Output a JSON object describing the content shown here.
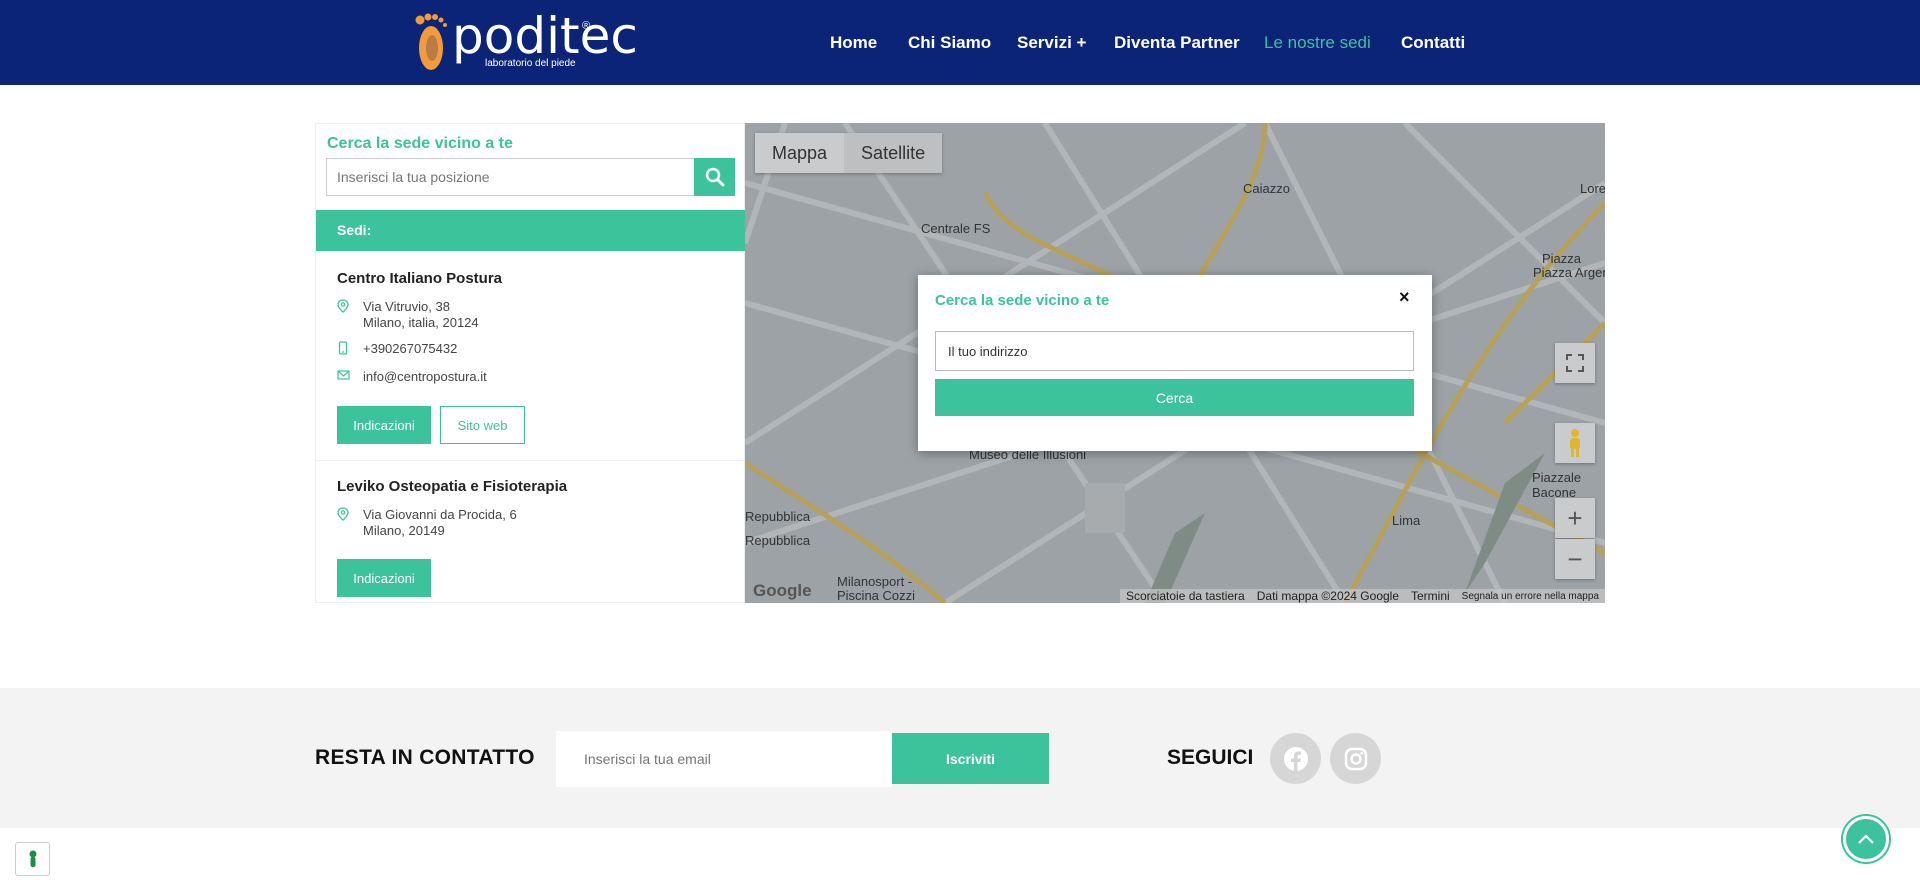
{
  "header": {
    "logo_text": "poditec",
    "logo_reg": "®",
    "logo_tagline": "laboratorio del piede",
    "nav": [
      "Home",
      "Chi Siamo",
      "Servizi +",
      "Diventa Partner",
      "Le nostre sedi",
      "Contatti"
    ],
    "active_nav": "Le nostre sedi"
  },
  "sidebar": {
    "title": "Cerca la sede vicino a te",
    "search_placeholder": "Inserisci la tua posizione",
    "sedi_label": "Sedi:",
    "locations": [
      {
        "name": "Centro Italiano Postura",
        "address_line1": "Via Vitruvio, 38",
        "address_line2": "Milano, italia, 20124",
        "phone": "+390267075432",
        "email": "info@centropostura.it",
        "btn_directions": "Indicazioni",
        "btn_website": "Sito web"
      },
      {
        "name": "Leviko Osteopatia e Fisioterapia",
        "address_line1": "Via Giovanni da Procida, 6",
        "address_line2": "Milano, 20149",
        "btn_directions": "Indicazioni"
      }
    ]
  },
  "map": {
    "btn_map": "Mappa",
    "btn_satellite": "Satellite",
    "labels": [
      "Caiazzo",
      "Centrale FS",
      "Piazza Argentina",
      "Loreto",
      "Museo delle Illusioni",
      "Piazzale Bacone",
      "Lima",
      "Repubblica",
      "Repubblica",
      "Milanosport - Piscina Cozzi"
    ],
    "google": "Google",
    "footer_shortcuts": "Scorciatoie da tastiera",
    "footer_data": "Dati mappa ©2024 Google",
    "footer_terms": "Termini",
    "footer_report": "Segnala un errore nella mappa",
    "zoom_in": "+",
    "zoom_out": "−"
  },
  "modal": {
    "title": "Cerca la sede vicino a te",
    "close": "×",
    "input_value": "Il tuo indirizzo",
    "button": "Cerca"
  },
  "footer": {
    "resta": "RESTA IN CONTATTO",
    "email_placeholder": "Inserisci la tua email",
    "subscribe": "Iscriviti",
    "seguici": "SEGUICI",
    "social_icons": [
      "facebook-icon",
      "instagram-icon"
    ]
  },
  "colors": {
    "brand_blue": "#0b2478",
    "accent_green": "#3cc39b",
    "logo_orange": "#f39a3a"
  }
}
